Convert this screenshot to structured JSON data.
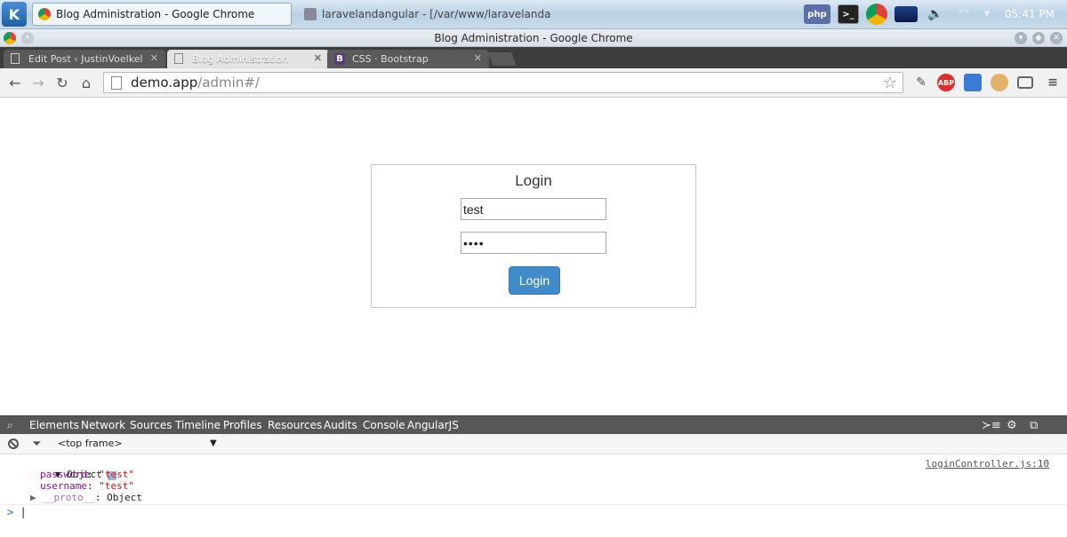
{
  "taskbar": {
    "tasks": [
      {
        "label": "Blog Administration - Google Chrome"
      },
      {
        "label": "laravelandangular - [/var/www/laravelandangular.co"
      }
    ],
    "clock": "05:41 PM"
  },
  "window": {
    "title": "Blog Administration - Google Chrome"
  },
  "tabs": [
    {
      "label": "Edit Post ‹ JustinVoelkel"
    },
    {
      "label": "Blog Administration"
    },
    {
      "label": "CSS · Bootstrap",
      "icon_letter": "B"
    }
  ],
  "omnibox": {
    "host": "demo.app",
    "path": "/admin#/"
  },
  "login": {
    "title": "Login",
    "username_value": "test",
    "password_value": "••••",
    "button_label": "Login"
  },
  "devtools": {
    "tabs": [
      "Elements",
      "Network",
      "Sources",
      "Timeline",
      "Profiles",
      "Resources",
      "Audits",
      "Console",
      "AngularJS"
    ],
    "selected_tab": "Console",
    "frame": "<top frame>",
    "log": {
      "object_label": "Object",
      "source": "loginController.js:10",
      "props": [
        {
          "key": "password",
          "value": "\"test\""
        },
        {
          "key": "username",
          "value": "\"test\""
        }
      ],
      "proto_key": "__proto__",
      "proto_value": "Object"
    },
    "prompt": ">"
  },
  "colors": {
    "primary_button": "#428bca",
    "devtools_tabbar": "#575757",
    "tab_strip": "#3d3d3d"
  }
}
